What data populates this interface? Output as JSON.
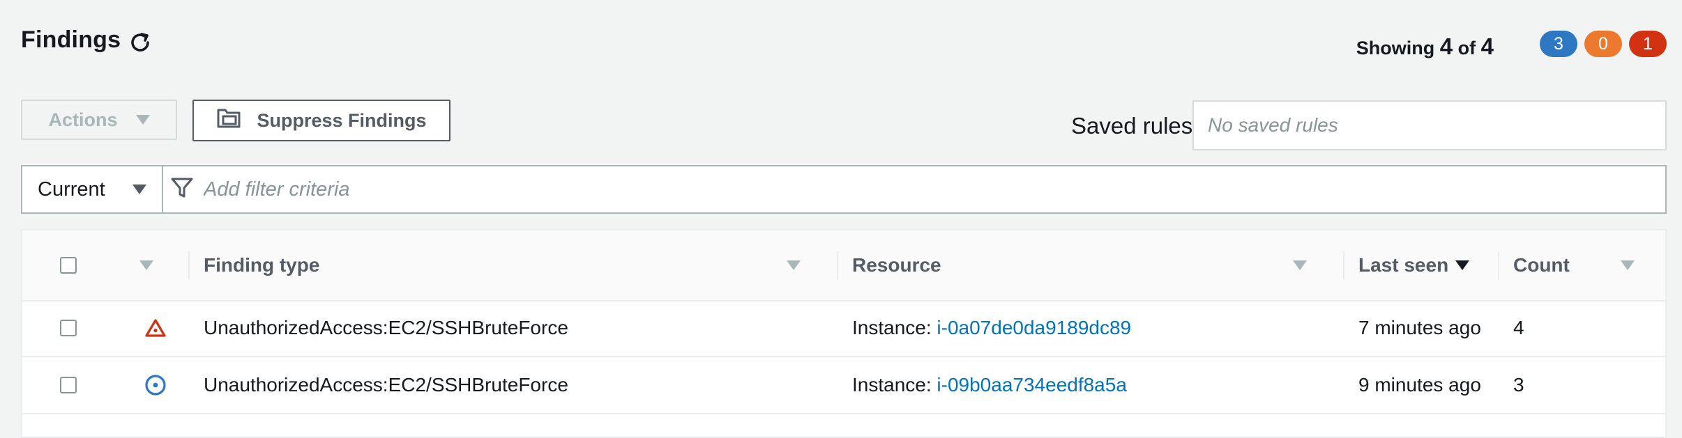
{
  "header": {
    "title": "Findings",
    "showing_label": "Showing",
    "shown_count": "4",
    "of_label": "of",
    "total_count": "4",
    "badges": [
      {
        "value": "3",
        "color": "#2e78c2"
      },
      {
        "value": "0",
        "color": "#eb7a2e"
      },
      {
        "value": "1",
        "color": "#d13212"
      }
    ]
  },
  "toolbar": {
    "actions_label": "Actions",
    "suppress_label": "Suppress Findings",
    "saved_rules_label": "Saved rules",
    "saved_rules_placeholder": "No saved rules"
  },
  "filter": {
    "scope_value": "Current",
    "placeholder": "Add filter criteria"
  },
  "table": {
    "columns": {
      "finding_type": "Finding type",
      "resource": "Resource",
      "last_seen": "Last seen",
      "count": "Count"
    },
    "rows": [
      {
        "severity": "high",
        "severity_icon": "warning-triangle-icon",
        "severity_color": "#d13212",
        "finding_type": "UnauthorizedAccess:EC2/SSHBruteForce",
        "resource_prefix": "Instance:",
        "resource_id": "i-0a07de0da9189dc89",
        "last_seen": "7 minutes ago",
        "count": "4"
      },
      {
        "severity": "low",
        "severity_icon": "info-circle-icon",
        "severity_color": "#2e78c2",
        "finding_type": "UnauthorizedAccess:EC2/SSHBruteForce",
        "resource_prefix": "Instance:",
        "resource_id": "i-09b0aa734eedf8a5a",
        "last_seen": "9 minutes ago",
        "count": "3"
      }
    ]
  },
  "colors": {
    "background": "#f2f3f3",
    "link": "#0073bb",
    "text": "#16191f"
  }
}
